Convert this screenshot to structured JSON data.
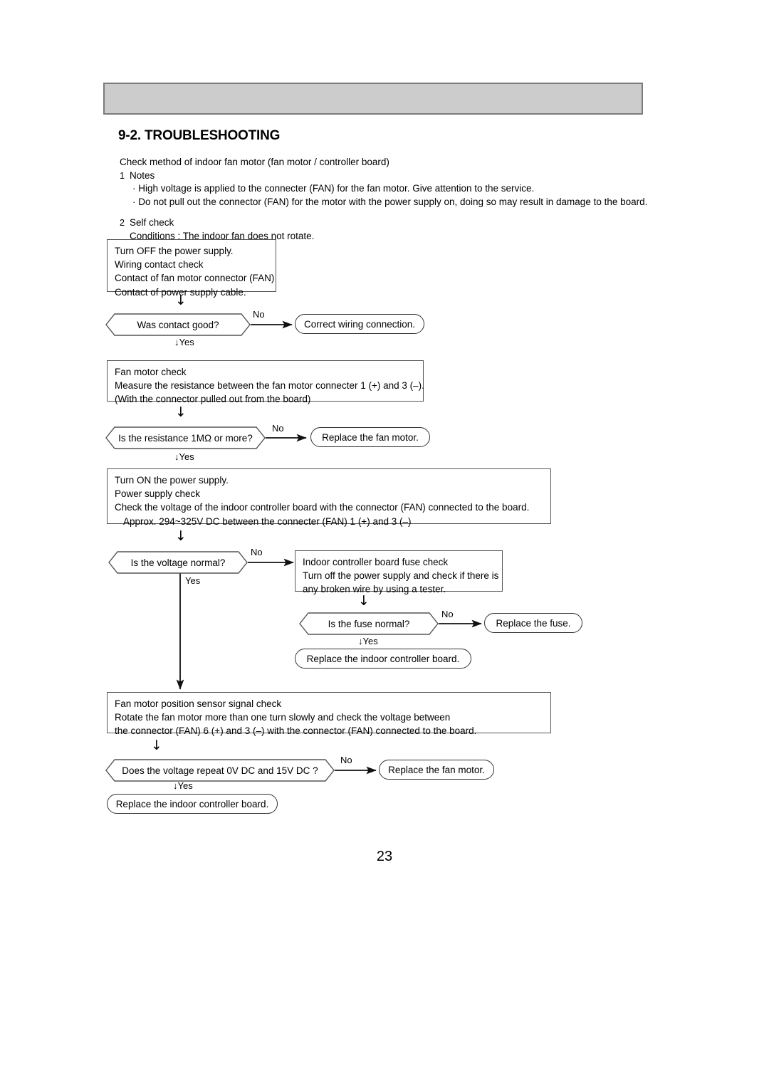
{
  "document": {
    "section_number": "9-2.",
    "section_title": "9-2. TROUBLESHOOTING",
    "page_number": "23"
  },
  "intro": {
    "lead": "Check method of indoor fan motor (fan motor / controller board)",
    "item1_num": "1",
    "item1_label": "Notes",
    "item1_bullets": [
      "· High voltage is applied to the connecter (FAN) for the fan motor. Give attention to the service.",
      "· Do not pull out the connector (FAN) for the motor with the power supply on, doing so may result in damage to the board."
    ],
    "item2_num": "2",
    "item2_label": "Self check",
    "item2_condition": "Conditions : The indoor fan does not rotate."
  },
  "flow": {
    "box_power_off": {
      "lines": [
        "Turn OFF the power supply.",
        "Wiring contact check",
        "Contact of fan motor connector (FAN)",
        "Contact of power supply cable."
      ]
    },
    "decision_contact": {
      "text": "Was contact good?",
      "no_label": "No",
      "yes_label": "Yes"
    },
    "terminal_correct_wiring": {
      "text": "Correct wiring connection."
    },
    "box_fan_motor_check": {
      "lines": [
        "Fan motor check",
        "Measure the resistance between the fan motor connecter 1 (+) and 3 (–).",
        "(With the connector pulled out from the board)"
      ]
    },
    "decision_resistance": {
      "text": "Is the resistance 1MΩ or more?",
      "no_label": "No",
      "yes_label": "Yes"
    },
    "terminal_replace_fan_motor_1": {
      "text": "Replace the fan motor."
    },
    "box_power_on": {
      "lines": [
        "Turn ON the power supply.",
        "Power supply check",
        "Check the voltage of the indoor controller board with the connector (FAN) connected to the board.",
        "Approx. 294~325V DC between the connecter (FAN) 1 (+) and 3 (–)"
      ]
    },
    "decision_voltage": {
      "text": "Is the voltage normal?",
      "no_label": "No",
      "yes_label": "Yes"
    },
    "box_fuse_check": {
      "lines": [
        "Indoor controller board fuse check",
        "Turn off the power supply and check if there is",
        "any broken wire by using a tester."
      ]
    },
    "decision_fuse": {
      "text": "Is the fuse normal?",
      "no_label": "No",
      "yes_label": "Yes"
    },
    "terminal_replace_fuse": {
      "text": "Replace the fuse."
    },
    "terminal_replace_board_1": {
      "text": "Replace the indoor controller board."
    },
    "box_position_sensor": {
      "lines": [
        "Fan motor position sensor signal check",
        "Rotate the fan motor more than one turn slowly and check the voltage between",
        "the connector (FAN) 6 (+) and 3 (–) with the connector (FAN) connected to the board."
      ]
    },
    "decision_repeat_voltage": {
      "text": "Does the voltage repeat 0V DC and 15V DC ?",
      "no_label": "No",
      "yes_label": "Yes"
    },
    "terminal_replace_fan_motor_2": {
      "text": "Replace the fan motor."
    },
    "terminal_replace_board_2": {
      "text": "Replace the indoor controller board."
    }
  },
  "icons": {
    "arrow_down": "↓"
  },
  "colors": {
    "header_fill": "#cccccc",
    "header_border": "#7b7b7b",
    "line": "#333333",
    "text": "#000000"
  }
}
